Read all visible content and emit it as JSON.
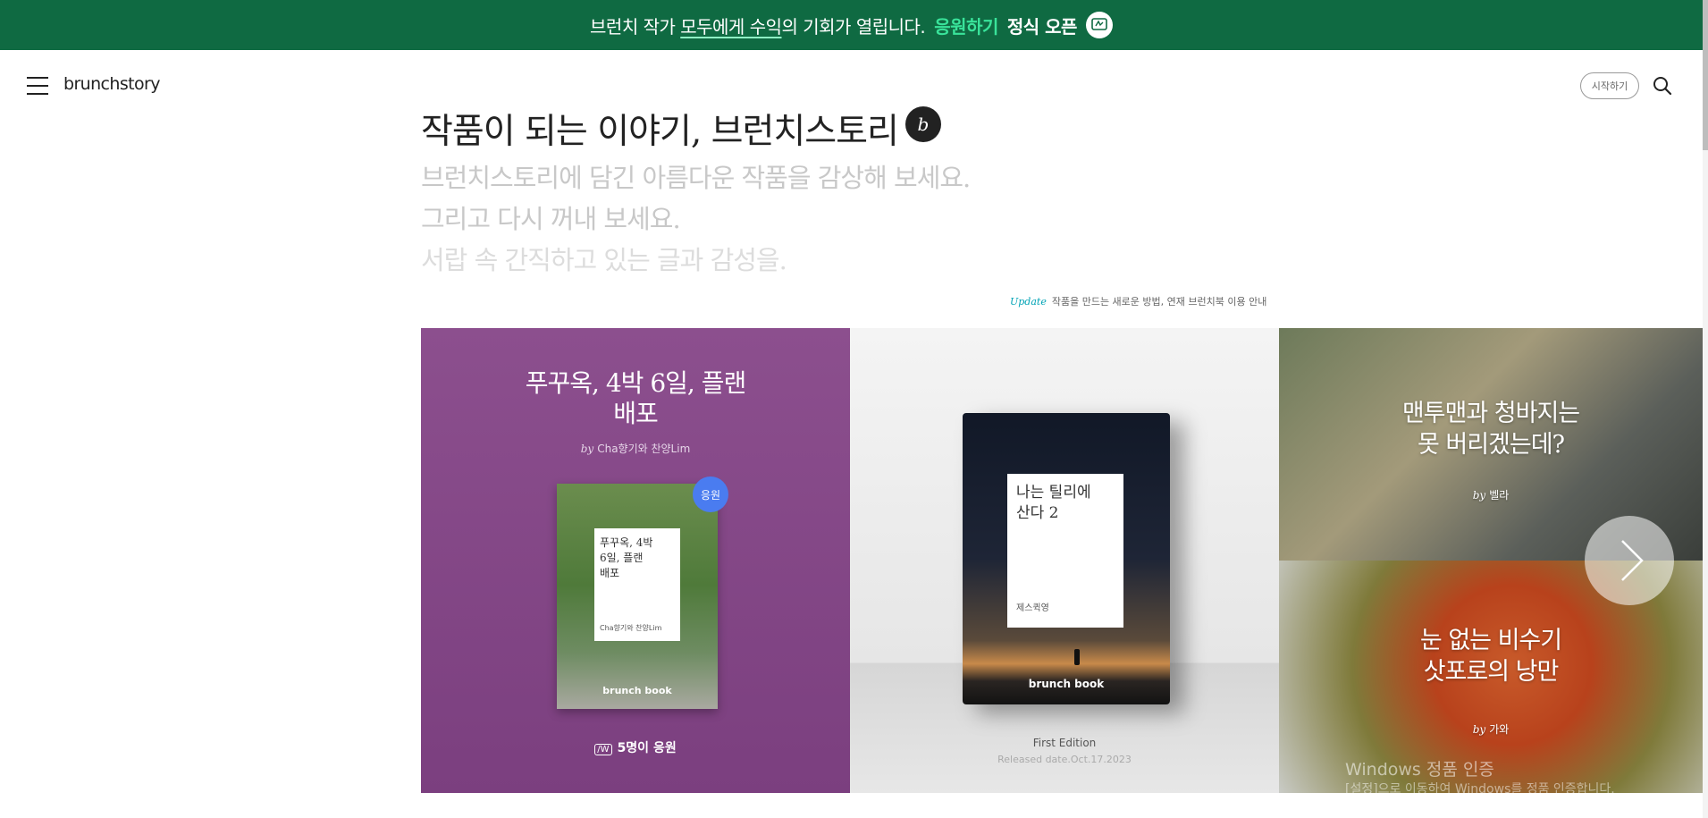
{
  "banner": {
    "text_prefix": "브런치 작가 ",
    "text_underlined": "모두에게 수익",
    "text_suffix": "의 기회가 열립니다.",
    "cta_label": "응원하기",
    "cta_suffix": "정식 오픈",
    "badge_icon": "응원하기 아이콘"
  },
  "header": {
    "menu_icon": "hamburger-menu-icon",
    "logo": "brunchstory",
    "start_label": "시작하기",
    "search_icon": "search-icon"
  },
  "hero": {
    "title": "작품이 되는 이야기, 브런치스토리",
    "badge_glyph": "b",
    "lines": [
      "브런치스토리에 담긴 아름다운 작품을 감상해 보세요.",
      "그리고 다시 꺼내 보세요.",
      "서랍 속 간직하고 있는 글과 감성을."
    ],
    "update_tag": "Update",
    "update_text": "작품을 만드는 새로운 방법, 연재 브런치북 이용 안내"
  },
  "cards": {
    "featured": {
      "title_line1": "푸꾸옥, 4박 6일, 플랜",
      "title_line2": "배포",
      "by_prefix": "by",
      "author": "Cha향기와 찬양Lim",
      "book_title_line1": "푸꾸옥, 4박",
      "book_title_line2": "6일, 플랜",
      "book_title_line3": "배포",
      "book_author": "Cha향기와 찬양Lim",
      "book_brand": "brunch book",
      "badge": "응원",
      "support_icon": "응원 아이콘",
      "support_count": "5명이 응원"
    },
    "book": {
      "book_title_line1": "나는 틸리에",
      "book_title_line2": "산다 2",
      "book_author": "제스퀵영",
      "book_brand": "brunch book",
      "edition": "First Edition",
      "released": "Released date.Oct.17.2023"
    },
    "photo1": {
      "title_line1": "맨투맨과 청바지는",
      "title_line2": "못 버리겠는데?",
      "by_prefix": "by",
      "author": "벨라"
    },
    "photo2": {
      "title_line1": "눈 없는 비수기",
      "title_line2": "삿포로의 낭만",
      "by_prefix": "by",
      "author": "가와"
    }
  },
  "carousel": {
    "next_icon": "chevron-right-icon"
  },
  "os_overlay": {
    "line1": "Windows 정품 인증",
    "line2": "[설정]으로 이동하여 Windows를 정품 인증합니다."
  }
}
